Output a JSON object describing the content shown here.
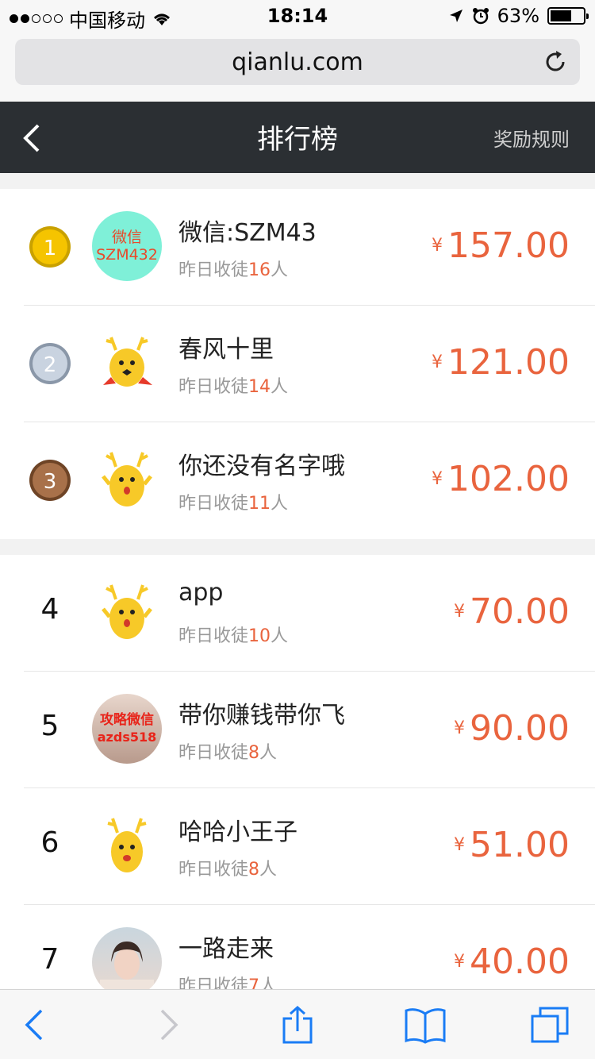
{
  "status_bar": {
    "carrier": "中国移动",
    "time": "18:14",
    "battery": "63%"
  },
  "browser": {
    "url": "qianlu.com"
  },
  "nav": {
    "title": "排行榜",
    "rule_link": "奖励规则"
  },
  "subtitle_prefix": "昨日收徒",
  "subtitle_suffix": "人",
  "currency": "¥",
  "accent_color": "#e9643e",
  "top3": [
    {
      "rank": "1",
      "medal": "gold",
      "name": "微信:SZM43",
      "count": "16",
      "amount": "157.00",
      "avatar_text": [
        "微信",
        "SZM432"
      ]
    },
    {
      "rank": "2",
      "medal": "silver",
      "name": "春风十里",
      "count": "14",
      "amount": "121.00"
    },
    {
      "rank": "3",
      "medal": "bronze",
      "name": "你还没有名字哦",
      "count": "11",
      "amount": "102.00"
    }
  ],
  "others": [
    {
      "rank": "4",
      "name": "app",
      "count": "10",
      "amount": "70.00"
    },
    {
      "rank": "5",
      "name": "带你赚钱带你飞",
      "count": "8",
      "amount": "90.00",
      "avatar_text": [
        "攻略微信",
        "azds518"
      ]
    },
    {
      "rank": "6",
      "name": "哈哈小王子",
      "count": "8",
      "amount": "51.00"
    },
    {
      "rank": "7",
      "name": "一路走来",
      "count": "7",
      "amount": "40.00"
    }
  ]
}
